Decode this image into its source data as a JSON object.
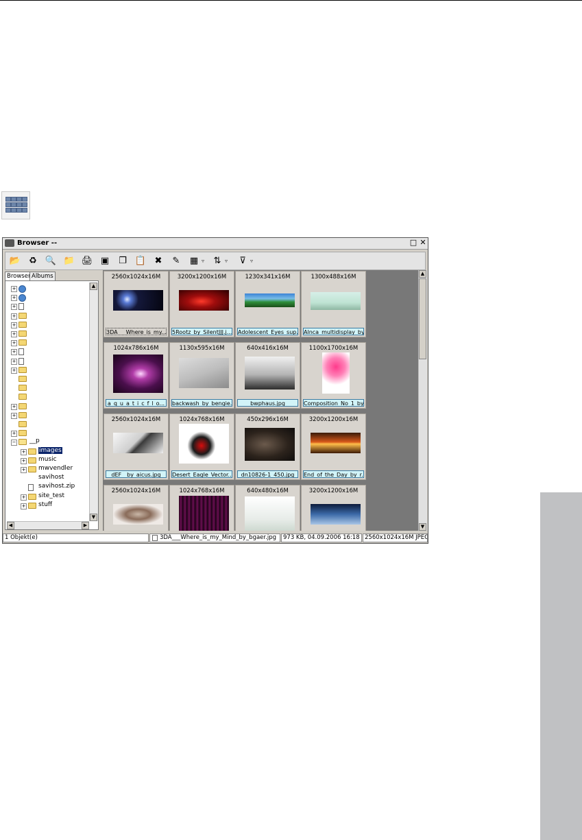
{
  "window": {
    "title": "Browser --",
    "maximize_icon": "□",
    "close_icon": "✕"
  },
  "toolbar": {
    "buttons": [
      {
        "name": "open-folder-icon",
        "glyph": "📂"
      },
      {
        "name": "refresh-icon",
        "glyph": "♻"
      },
      {
        "name": "search-icon",
        "glyph": "🔍"
      },
      {
        "name": "folder-icon",
        "glyph": "📁"
      },
      {
        "name": "print-icon",
        "glyph": "🖨"
      },
      {
        "name": "slideshow-icon",
        "glyph": "▣"
      },
      {
        "name": "copy-icon",
        "glyph": "❐"
      },
      {
        "name": "paste-icon",
        "glyph": "📋"
      },
      {
        "name": "delete-icon",
        "glyph": "✖"
      },
      {
        "name": "edit-icon",
        "glyph": "✎"
      },
      {
        "name": "view-mode-icon",
        "glyph": "▦"
      },
      {
        "name": "sort-icon",
        "glyph": "⇅"
      },
      {
        "name": "filter-icon",
        "glyph": "⊽"
      }
    ],
    "dropdown_glyph": "▿"
  },
  "tabs": {
    "browser": "Browser",
    "albums": "Albums"
  },
  "tree": {
    "root_label": "__p",
    "children": [
      "images",
      "music",
      "mwvendler",
      "savihost",
      "savihost.zip",
      "site_test",
      "stuff"
    ]
  },
  "thumbnails": [
    {
      "dims": "2560x1024x16M",
      "name": "3DA___Where_is_my..."
    },
    {
      "dims": "3200x1200x16M",
      "name": "5Rootz_by_SilentJJJ.j..."
    },
    {
      "dims": "1230x341x16M",
      "name": "Adolescent_Eyes_sup..."
    },
    {
      "dims": "1300x488x16M",
      "name": "Alnca_multidisplay_by..."
    },
    {
      "dims": "1024x786x16M",
      "name": "a_q_u_a_t_i_c_f_l_o..."
    },
    {
      "dims": "1130x595x16M",
      "name": "backwash_by_bengie..."
    },
    {
      "dims": "640x416x16M",
      "name": "bwphaus.jpg"
    },
    {
      "dims": "1100x1700x16M",
      "name": "Composition_No_1_by..."
    },
    {
      "dims": "2560x1024x16M",
      "name": "dEF__by_aicus.jpg"
    },
    {
      "dims": "1024x768x16M",
      "name": "Desert_Eagle_Vector..."
    },
    {
      "dims": "450x296x16M",
      "name": "dn10826-1_450.jpg"
    },
    {
      "dims": "3200x1200x16M",
      "name": "End_of_the_Day_by_r..."
    },
    {
      "dims": "2560x1024x16M",
      "name": ""
    },
    {
      "dims": "1024x768x16M",
      "name": ""
    },
    {
      "dims": "640x480x16M",
      "name": ""
    },
    {
      "dims": "3200x1200x16M",
      "name": ""
    }
  ],
  "status": {
    "selection": "1 Objekt(e)",
    "filename": "3DA___Where_is_my_Mind_by_bgaer.jpg",
    "size_date": "973 KB,  04.09.2006 16:18",
    "info": "2560x1024x16M JPEG"
  },
  "colors": {
    "selection": "#0a246a",
    "name_bg": "#d2f4f8",
    "grid_bg": "#787878",
    "side_tab": "#c0c1c3"
  }
}
